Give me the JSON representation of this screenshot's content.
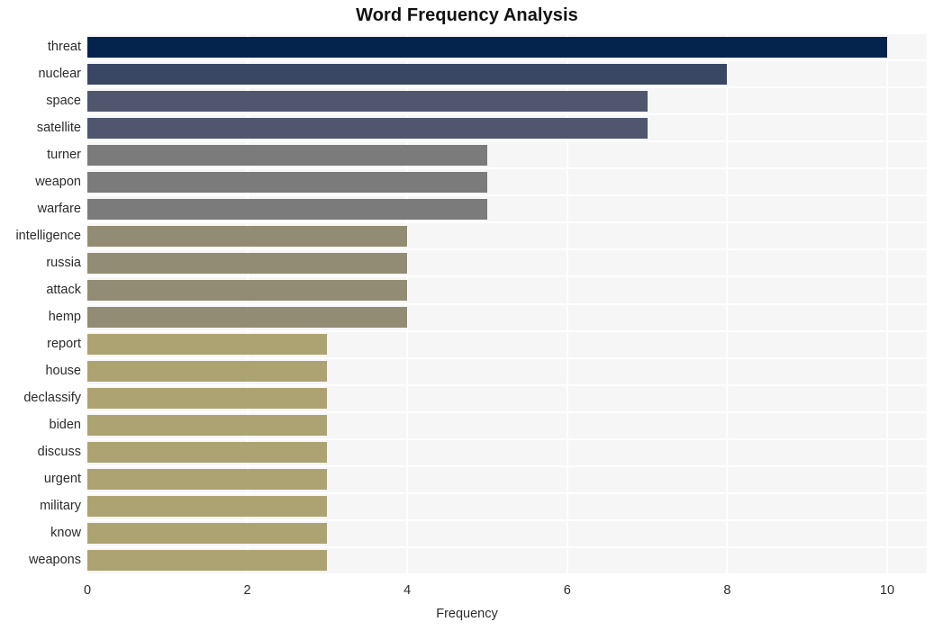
{
  "chart_data": {
    "type": "bar",
    "orientation": "horizontal",
    "title": "Word Frequency Analysis",
    "xlabel": "Frequency",
    "ylabel": "",
    "xlim": [
      0,
      10.5
    ],
    "xticks": [
      0,
      2,
      4,
      6,
      8,
      10
    ],
    "xtick_labels": [
      "0",
      "2",
      "4",
      "6",
      "8",
      "10"
    ],
    "grid": true,
    "legend": null,
    "categories": [
      "threat",
      "nuclear",
      "space",
      "satellite",
      "turner",
      "weapon",
      "warfare",
      "intelligence",
      "russia",
      "attack",
      "hemp",
      "report",
      "house",
      "declassify",
      "biden",
      "discuss",
      "urgent",
      "military",
      "know",
      "weapons"
    ],
    "values": [
      10,
      8,
      7,
      7,
      5,
      5,
      5,
      4,
      4,
      4,
      4,
      3,
      3,
      3,
      3,
      3,
      3,
      3,
      3,
      3
    ],
    "bar_colors": [
      "#04234d",
      "#394664",
      "#4f566e",
      "#4f566e",
      "#7b7b7b",
      "#7b7b7b",
      "#7b7b7b",
      "#928c74",
      "#928c74",
      "#928c74",
      "#928c74",
      "#ada372",
      "#ada372",
      "#ada372",
      "#ada372",
      "#ada372",
      "#ada372",
      "#ada372",
      "#ada372",
      "#ada372"
    ]
  },
  "style": {
    "plot_background": "#f6f6f7",
    "figure_background": "#ffffff",
    "gridline_color": "#ffffff",
    "text_color": "#2b2b2b",
    "title_color": "#121212"
  }
}
